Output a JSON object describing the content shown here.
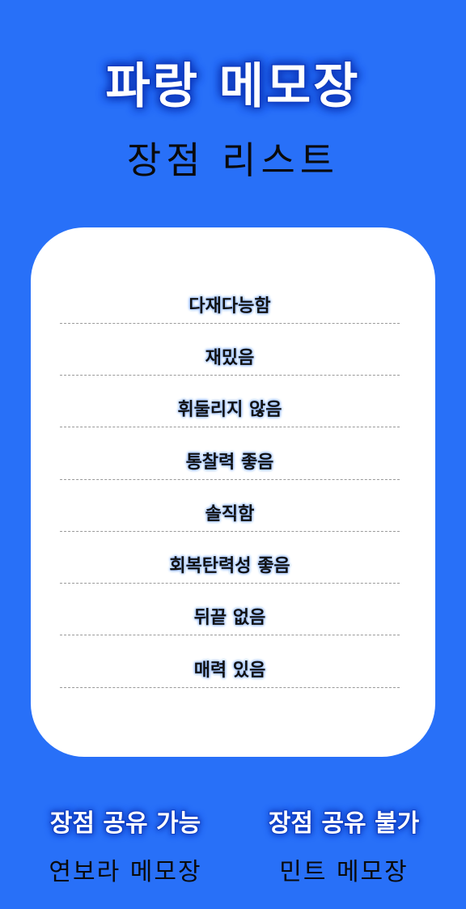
{
  "header": {
    "title": "파랑 메모장",
    "subtitle": "장점 리스트"
  },
  "list": {
    "items": [
      "다재다능함",
      "재밌음",
      "휘둘리지 않음",
      "통찰력 좋음",
      "솔직함",
      "회복탄력성 좋음",
      "뒤끝 없음",
      "매력 있음"
    ]
  },
  "footer": {
    "left_badge": "장점 공유 가능",
    "left_label": "연보라 메모장",
    "right_badge": "장점 공유 불가",
    "right_label": "민트 메모장"
  },
  "colors": {
    "background": "#2870F8",
    "card": "#FFFFFF",
    "title_outline": "#1747C8",
    "item_glow": "#9CC0FF"
  }
}
